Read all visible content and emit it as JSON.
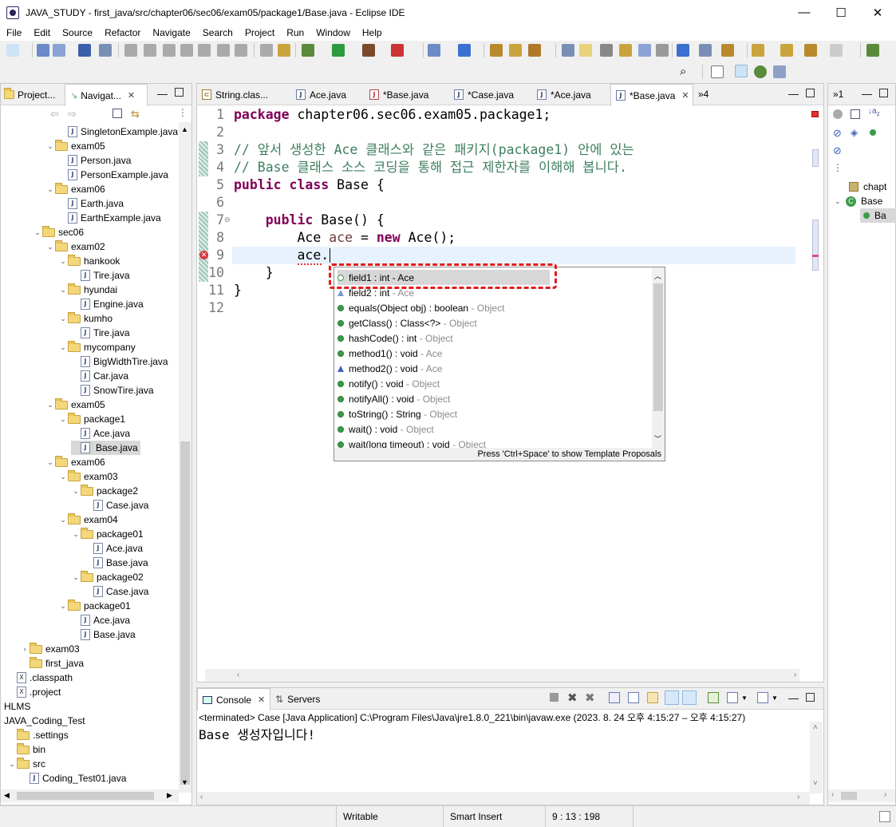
{
  "window": {
    "title": "JAVA_STUDY - first_java/src/chapter06/sec06/exam05/package1/Base.java - Eclipse IDE",
    "min": "—",
    "max": "☐",
    "close": "✕"
  },
  "menu": [
    "File",
    "Edit",
    "Source",
    "Refactor",
    "Navigate",
    "Search",
    "Project",
    "Run",
    "Window",
    "Help"
  ],
  "navigator": {
    "tabs": [
      {
        "label": "Project..."
      },
      {
        "label": "Navigat..."
      }
    ],
    "rows": [
      {
        "label": "SingletonExample.java",
        "kind": "java",
        "indent": 4,
        "expanded": null,
        "selected": false
      },
      {
        "label": "exam05",
        "kind": "folder",
        "indent": 3,
        "expanded": true,
        "selected": false
      },
      {
        "label": "Person.java",
        "kind": "java",
        "indent": 4,
        "expanded": null,
        "selected": false
      },
      {
        "label": "PersonExample.java",
        "kind": "java",
        "indent": 4,
        "expanded": null,
        "selected": false
      },
      {
        "label": "exam06",
        "kind": "folder",
        "indent": 3,
        "expanded": true,
        "selected": false
      },
      {
        "label": "Earth.java",
        "kind": "java",
        "indent": 4,
        "expanded": null,
        "selected": false
      },
      {
        "label": "EarthExample.java",
        "kind": "java",
        "indent": 4,
        "expanded": null,
        "selected": false
      },
      {
        "label": "sec06",
        "kind": "folder",
        "indent": 2,
        "expanded": true,
        "selected": false
      },
      {
        "label": "exam02",
        "kind": "folder",
        "indent": 3,
        "expanded": true,
        "selected": false
      },
      {
        "label": "hankook",
        "kind": "folder",
        "indent": 4,
        "expanded": true,
        "selected": false
      },
      {
        "label": "Tire.java",
        "kind": "java",
        "indent": 5,
        "expanded": null,
        "selected": false
      },
      {
        "label": "hyundai",
        "kind": "folder",
        "indent": 4,
        "expanded": true,
        "selected": false
      },
      {
        "label": "Engine.java",
        "kind": "java",
        "indent": 5,
        "expanded": null,
        "selected": false
      },
      {
        "label": "kumho",
        "kind": "folder",
        "indent": 4,
        "expanded": true,
        "selected": false
      },
      {
        "label": "Tire.java",
        "kind": "java",
        "indent": 5,
        "expanded": null,
        "selected": false
      },
      {
        "label": "mycompany",
        "kind": "folder",
        "indent": 4,
        "expanded": true,
        "selected": false
      },
      {
        "label": "BigWidthTire.java",
        "kind": "java",
        "indent": 5,
        "expanded": null,
        "selected": false
      },
      {
        "label": "Car.java",
        "kind": "java",
        "indent": 5,
        "expanded": null,
        "selected": false
      },
      {
        "label": "SnowTire.java",
        "kind": "java",
        "indent": 5,
        "expanded": null,
        "selected": false
      },
      {
        "label": "exam05",
        "kind": "folder",
        "indent": 3,
        "expanded": true,
        "selected": false
      },
      {
        "label": "package1",
        "kind": "folder",
        "indent": 4,
        "expanded": true,
        "selected": false
      },
      {
        "label": "Ace.java",
        "kind": "java",
        "indent": 5,
        "expanded": null,
        "selected": false
      },
      {
        "label": "Base.java",
        "kind": "java",
        "indent": 5,
        "expanded": null,
        "selected": true
      },
      {
        "label": "exam06",
        "kind": "folder",
        "indent": 3,
        "expanded": true,
        "selected": false
      },
      {
        "label": "exam03",
        "kind": "folder",
        "indent": 4,
        "expanded": true,
        "selected": false
      },
      {
        "label": "package2",
        "kind": "folder",
        "indent": 5,
        "expanded": true,
        "selected": false
      },
      {
        "label": "Case.java",
        "kind": "java",
        "indent": 6,
        "expanded": null,
        "selected": false
      },
      {
        "label": "exam04",
        "kind": "folder",
        "indent": 4,
        "expanded": true,
        "selected": false
      },
      {
        "label": "package01",
        "kind": "folder",
        "indent": 5,
        "expanded": true,
        "selected": false
      },
      {
        "label": "Ace.java",
        "kind": "java",
        "indent": 6,
        "expanded": null,
        "selected": false
      },
      {
        "label": "Base.java",
        "kind": "java",
        "indent": 6,
        "expanded": null,
        "selected": false
      },
      {
        "label": "package02",
        "kind": "folder",
        "indent": 5,
        "expanded": true,
        "selected": false
      },
      {
        "label": "Case.java",
        "kind": "java",
        "indent": 6,
        "expanded": null,
        "selected": false
      },
      {
        "label": "package01",
        "kind": "folder",
        "indent": 4,
        "expanded": true,
        "selected": false
      },
      {
        "label": "Ace.java",
        "kind": "java",
        "indent": 5,
        "expanded": null,
        "selected": false
      },
      {
        "label": "Base.java",
        "kind": "java",
        "indent": 5,
        "expanded": null,
        "selected": false
      },
      {
        "label": "exam03",
        "kind": "folder",
        "indent": 1,
        "expanded": false,
        "selected": false
      },
      {
        "label": "first_java",
        "kind": "folder",
        "indent": 1,
        "expanded": null,
        "selected": false
      },
      {
        "label": ".classpath",
        "kind": "xml",
        "indent": 0,
        "expanded": null,
        "selected": false
      },
      {
        "label": ".project",
        "kind": "xml",
        "indent": 0,
        "expanded": null,
        "selected": false
      },
      {
        "label": "HLMS",
        "kind": "text",
        "indent": -1,
        "expanded": null,
        "selected": false
      },
      {
        "label": "JAVA_Coding_Test",
        "kind": "text",
        "indent": -1,
        "expanded": null,
        "selected": false
      },
      {
        "label": ".settings",
        "kind": "folder",
        "indent": 0,
        "expanded": null,
        "selected": false
      },
      {
        "label": "bin",
        "kind": "folder",
        "indent": 0,
        "expanded": null,
        "selected": false
      },
      {
        "label": "src",
        "kind": "folder",
        "indent": 0,
        "expanded": true,
        "selected": false
      },
      {
        "label": "Coding_Test01.java",
        "kind": "java",
        "indent": 1,
        "expanded": null,
        "selected": false
      }
    ]
  },
  "editor": {
    "tabs": [
      {
        "label": "String.clas...",
        "icon": "class-file-icon",
        "active": false
      },
      {
        "label": "Ace.java",
        "icon": "java-file-icon",
        "active": false
      },
      {
        "label": "*Base.java",
        "icon": "java-error-file-icon",
        "active": false
      },
      {
        "label": "*Case.java",
        "icon": "java-file-icon",
        "active": false
      },
      {
        "label": "*Ace.java",
        "icon": "java-file-icon",
        "active": false
      },
      {
        "label": "*Base.java",
        "icon": "java-file-icon",
        "active": true
      }
    ],
    "overflow": "»4",
    "lines": [
      {
        "n": "1",
        "html": "<span class='kw'>package</span> chapter06.sec06.exam05.package1;"
      },
      {
        "n": "2",
        "html": ""
      },
      {
        "n": "3",
        "html": "<span class='cm'>// 앞서 생성한 Ace 클래스와 같은 패키지(package1) 안에 있는</span>"
      },
      {
        "n": "4",
        "html": "<span class='cm'>// Base 클래스 소스 코딩을 통해 접근 제한자를 이해해 봅니다.</span>"
      },
      {
        "n": "5",
        "html": "<span class='kw'>public</span> <span class='kw'>class</span> Base {"
      },
      {
        "n": "6",
        "html": ""
      },
      {
        "n": "7",
        "html": "    <span class='kw'>public</span> Base() {"
      },
      {
        "n": "8",
        "html": "        Ace <span class='var'>ace</span> = <span class='kw'>new</span> Ace();"
      },
      {
        "n": "9",
        "html": "        ace."
      },
      {
        "n": "10",
        "html": "    }"
      },
      {
        "n": "11",
        "html": "}"
      },
      {
        "n": "12",
        "html": ""
      }
    ]
  },
  "completion": {
    "items": [
      {
        "main": "field1 : int",
        "owner": " - Ace",
        "icon": "dot-hollow"
      },
      {
        "main": "field2 : int",
        "owner": " - Ace",
        "icon": "tri-hollow"
      },
      {
        "main": "equals(Object obj) : boolean",
        "owner": " - Object",
        "icon": "dot"
      },
      {
        "main": "getClass() : Class<?>",
        "owner": " - Object",
        "icon": "dot"
      },
      {
        "main": "hashCode() : int",
        "owner": " - Object",
        "icon": "dot"
      },
      {
        "main": "method1() : void",
        "owner": " - Ace",
        "icon": "dot"
      },
      {
        "main": "method2() : void",
        "owner": " - Ace",
        "icon": "tri"
      },
      {
        "main": "notify() : void",
        "owner": " - Object",
        "icon": "dot"
      },
      {
        "main": "notifyAll() : void",
        "owner": " - Object",
        "icon": "dot"
      },
      {
        "main": "toString() : String",
        "owner": " - Object",
        "icon": "dot"
      },
      {
        "main": "wait() : void",
        "owner": " - Object",
        "icon": "dot"
      },
      {
        "main": "wait(long timeout) : void",
        "owner": " - Object",
        "icon": "dot"
      }
    ],
    "footer": "Press 'Ctrl+Space' to show Template Proposals"
  },
  "console": {
    "tabs": [
      {
        "label": "Console"
      },
      {
        "label": "Servers"
      }
    ],
    "header": "<terminated> Case [Java Application] C:\\Program Files\\Java\\jre1.8.0_221\\bin\\javaw.exe  (2023. 8. 24 오후 4:15:27 – 오후 4:15:27)",
    "output": "Base 생성자입니다!"
  },
  "outline": {
    "tab": "»1",
    "items": [
      {
        "label": "chapt"
      },
      {
        "label": "Base"
      },
      {
        "label": "Ba"
      }
    ]
  },
  "status": {
    "writable": "Writable",
    "insert_mode": "Smart Insert",
    "position": "9 : 13 : 198"
  }
}
